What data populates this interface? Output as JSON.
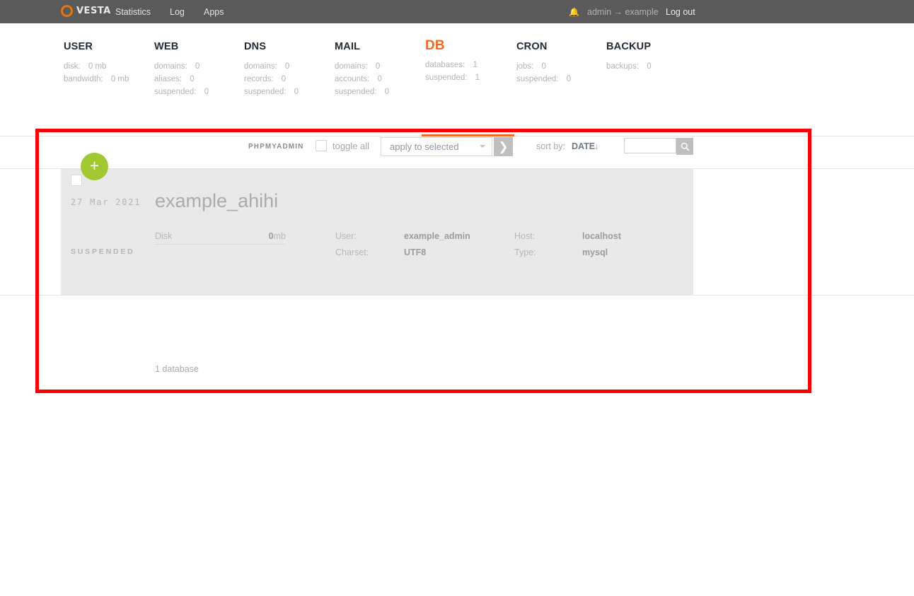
{
  "topbar": {
    "brand": "VESTA",
    "nav": [
      {
        "label": "Statistics"
      },
      {
        "label": "Log"
      },
      {
        "label": "Apps"
      }
    ],
    "bell_icon": "bell-icon",
    "user_switch": "admin → example",
    "logout": "Log out"
  },
  "stats": [
    {
      "title": "USER",
      "rows": [
        {
          "key": "disk:",
          "value": "0 mb"
        },
        {
          "key": "bandwidth:",
          "value": "0 mb"
        }
      ]
    },
    {
      "title": "WEB",
      "rows": [
        {
          "key": "domains:",
          "value": "0"
        },
        {
          "key": "aliases:",
          "value": "0"
        },
        {
          "key": "suspended:",
          "value": "0"
        }
      ]
    },
    {
      "title": "DNS",
      "rows": [
        {
          "key": "domains:",
          "value": "0"
        },
        {
          "key": "records:",
          "value": "0"
        },
        {
          "key": "suspended:",
          "value": "0"
        }
      ]
    },
    {
      "title": "MAIL",
      "rows": [
        {
          "key": "domains:",
          "value": "0"
        },
        {
          "key": "accounts:",
          "value": "0"
        },
        {
          "key": "suspended:",
          "value": "0"
        }
      ]
    },
    {
      "title": "DB",
      "rows": [
        {
          "key": "databases:",
          "value": "1"
        },
        {
          "key": "suspended:",
          "value": "1"
        }
      ]
    },
    {
      "title": "CRON",
      "rows": [
        {
          "key": "jobs:",
          "value": "0"
        },
        {
          "key": "suspended:",
          "value": "0"
        }
      ]
    },
    {
      "title": "BACKUP",
      "rows": [
        {
          "key": "backups:",
          "value": "0"
        }
      ]
    }
  ],
  "toolbar": {
    "phpmyadmin": "PHPMYADMIN",
    "toggle_all": "toggle all",
    "apply_selected": "apply to selected",
    "apply_go_icon": "chevron-right-icon",
    "sort_label": "sort by:",
    "sort_value": "DATE",
    "sort_direction_icon": "↓",
    "search_value": "",
    "search_placeholder": "",
    "search_icon": "search-icon"
  },
  "add_button": {
    "icon": "plus-icon",
    "label": "+"
  },
  "database": {
    "date": "27 Mar 2021",
    "status": "SUSPENDED",
    "name": "example_ahihi",
    "disk_label": "Disk",
    "disk_value": "0",
    "disk_unit": "mb",
    "fields": [
      {
        "label": "User:",
        "value": "example_admin"
      },
      {
        "label": "Charset:",
        "value": "UTF8"
      },
      {
        "label": "Host:",
        "value": "localhost"
      },
      {
        "label": "Type:",
        "value": "mysql"
      }
    ]
  },
  "footer": {
    "count": "1 database"
  },
  "colors": {
    "accent": "#f26822",
    "topbar": "#5a5a5a",
    "add_button": "#a0c830",
    "annotation": "#fb0000",
    "row_bg": "#e9e9e9"
  }
}
